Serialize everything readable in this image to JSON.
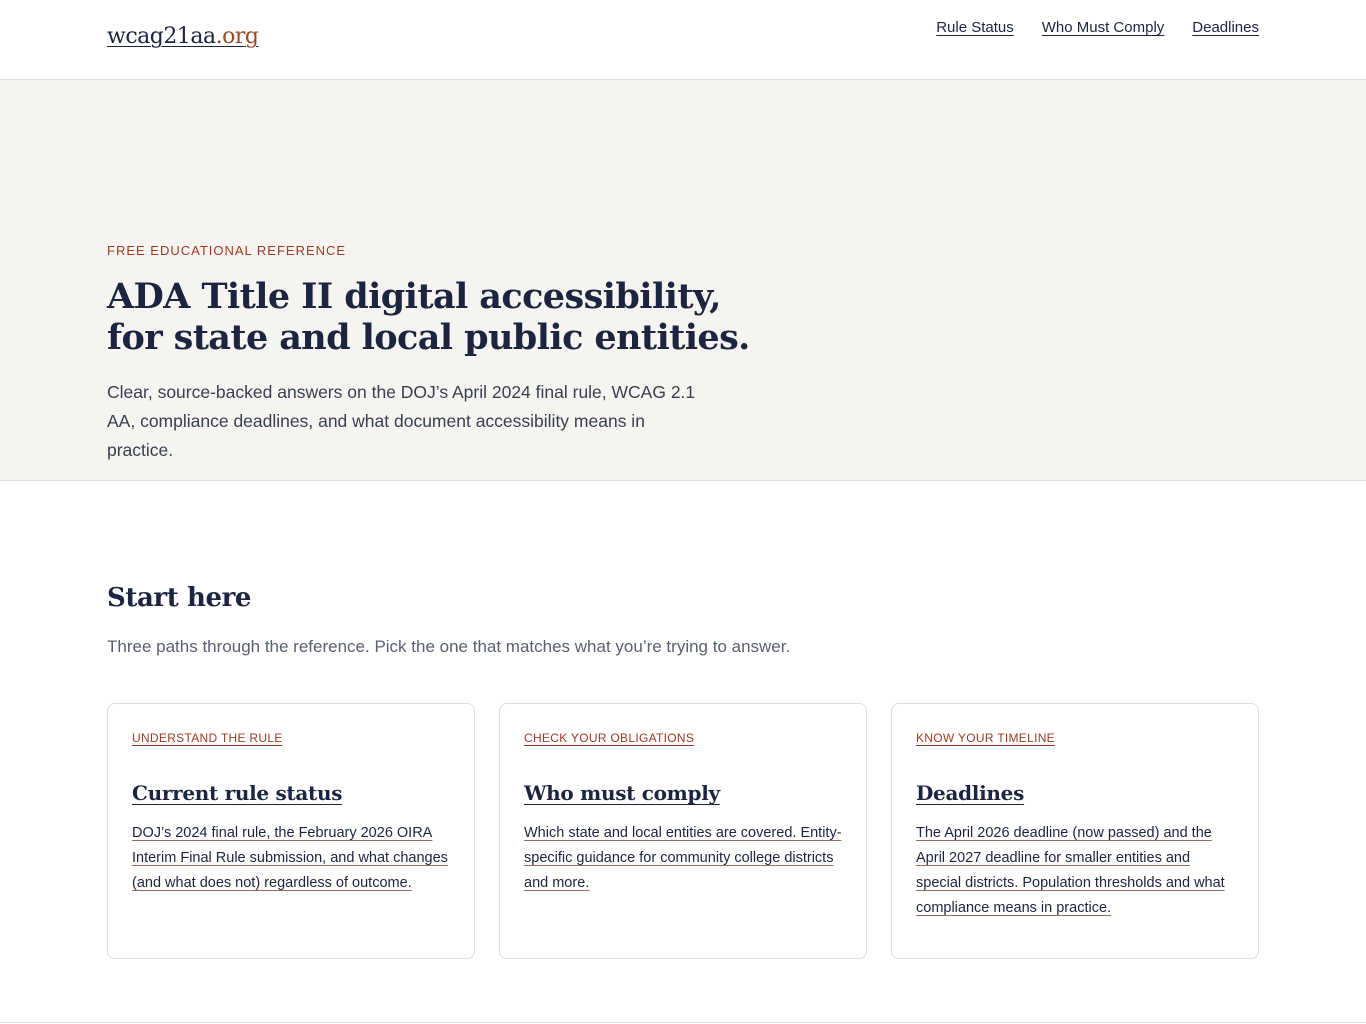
{
  "header": {
    "logo_main": "wcag21aa",
    "logo_tld": ".org",
    "nav": [
      {
        "label": "Rule Status"
      },
      {
        "label": "Who Must Comply"
      },
      {
        "label": "Deadlines"
      }
    ]
  },
  "hero": {
    "eyebrow": "FREE EDUCATIONAL REFERENCE",
    "title_line1": "ADA Title II digital accessibility,",
    "title_line2": "for state and local public entities.",
    "lede": "Clear, source-backed answers on the DOJ’s April 2024 final rule, WCAG 2.1 AA, compliance deadlines, and what document accessibility means in practice."
  },
  "start": {
    "title": "Start here",
    "subtitle": "Three paths through the reference. Pick the one that matches what you’re trying to answer."
  },
  "cards": [
    {
      "eyebrow": "UNDERSTAND THE RULE",
      "title": "Current rule status",
      "desc": "DOJ’s 2024 final rule, the February 2026 OIRA Interim Final Rule submission, and what changes (and what does not) regardless of outcome."
    },
    {
      "eyebrow": "CHECK YOUR OBLIGATIONS",
      "title": "Who must comply",
      "desc": "Which state and local entities are covered. Entity-specific guidance for community college districts and more."
    },
    {
      "eyebrow": "KNOW YOUR TIMELINE",
      "title": "Deadlines",
      "desc": "The April 2026 deadline (now passed) and the April 2027 deadline for smaller entities and special districts. Population thresholds and what compliance means in practice."
    }
  ],
  "colors": {
    "navy": "#1c2440",
    "accent": "#9a3a22",
    "hero_bg": "#f5f4f1"
  }
}
